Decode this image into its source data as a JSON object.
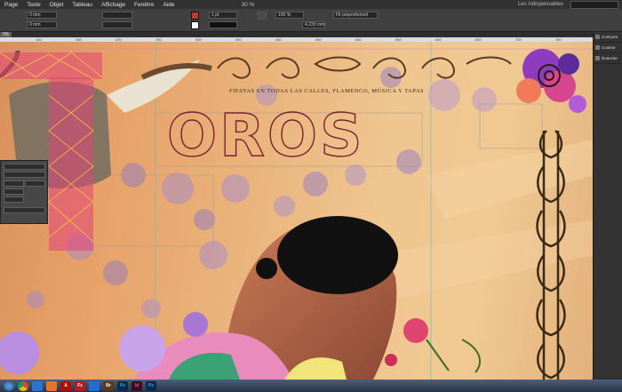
{
  "menubar": {
    "items": [
      "Page",
      "Texte",
      "Objet",
      "Tableau",
      "Affichage",
      "Fenêtre",
      "Aide"
    ],
    "zoom_level": "30 %",
    "workspace": "Les indispensables"
  },
  "control_panel": {
    "x_value": "0 mm",
    "y_value": "0 mm",
    "stroke_weight": "1 pt",
    "opacity_value": "100 %",
    "dimension_value": "4,233 mm",
    "frame_fitting": "Fit proportionnel",
    "fill_color": "#c0392b"
  },
  "document": {
    "tab_label": "0%",
    "ruler_ticks": [
      "100",
      "150",
      "200",
      "250",
      "300",
      "350",
      "400",
      "450",
      "500",
      "550",
      "600",
      "650",
      "700",
      "750"
    ]
  },
  "artwork": {
    "title_text": "OROS",
    "subtitle_text": "FIESTAS EN TODAS LAS CALLES, FLAMENCO, MÚSICA Y TAPAS",
    "canvas_color": "#e9b27a",
    "title_color": "#7a2030"
  },
  "left_panel": {
    "rows": [
      "",
      "",
      "",
      "",
      "",
      "",
      ""
    ]
  },
  "right_panels": {
    "items": [
      "Contours",
      "Couleur",
      "Nuancier"
    ]
  },
  "taskbar": {
    "apps": [
      "start",
      "chrome",
      "vlc",
      "explorer",
      "acrobat",
      "filezilla",
      "ie",
      "bridge",
      "photoshop",
      "indesign",
      "illustrator"
    ],
    "app_labels": {
      "acrobat": "A",
      "filezilla": "Fz",
      "bridge": "Br",
      "photoshop": "Ps",
      "indesign": "Id",
      "illustrator": "Ps"
    },
    "clock": ""
  }
}
